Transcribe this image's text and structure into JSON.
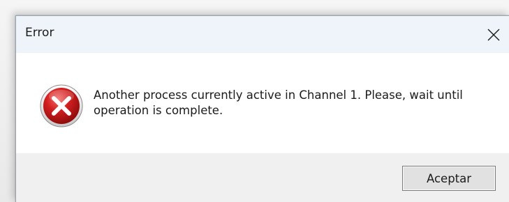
{
  "dialog": {
    "title": "Error",
    "close_icon": "close-icon",
    "message": "Another process currently active in Channel 1. Please, wait until operation is complete.",
    "icon": "error-icon",
    "button_label": "Aceptar"
  },
  "colors": {
    "titlebar_bg": "#eef4f9",
    "content_bg": "#ffffff",
    "footer_bg": "#f0f0f0",
    "error_red": "#d11a1a"
  }
}
